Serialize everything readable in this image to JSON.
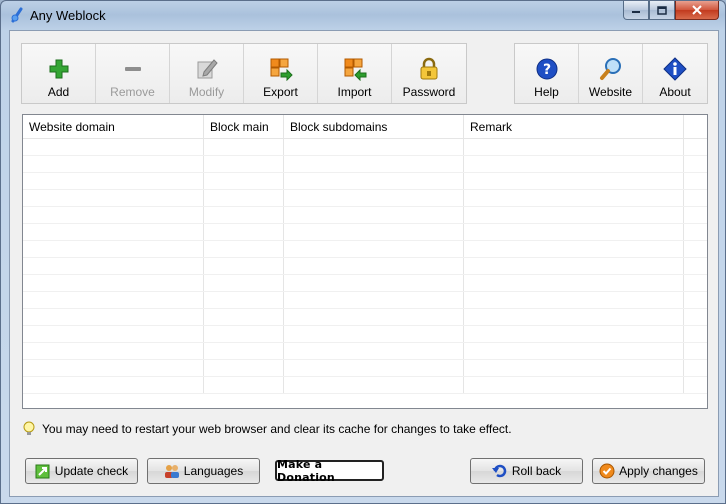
{
  "window": {
    "title": "Any Weblock"
  },
  "toolbar": {
    "left_buttons": [
      {
        "label": "Add",
        "icon": "plus-icon",
        "enabled": true
      },
      {
        "label": "Remove",
        "icon": "minus-icon",
        "enabled": false
      },
      {
        "label": "Modify",
        "icon": "pencil-icon",
        "enabled": false
      },
      {
        "label": "Export",
        "icon": "export-icon",
        "enabled": true
      },
      {
        "label": "Import",
        "icon": "import-icon",
        "enabled": true
      },
      {
        "label": "Password",
        "icon": "lock-icon",
        "enabled": true
      }
    ],
    "right_buttons": [
      {
        "label": "Help",
        "icon": "help-icon"
      },
      {
        "label": "Website",
        "icon": "magnifier-icon"
      },
      {
        "label": "About",
        "icon": "info-icon"
      }
    ]
  },
  "table": {
    "columns": [
      "Website domain",
      "Block main",
      "Block subdomains",
      "Remark"
    ],
    "rows": []
  },
  "notice": "You may need to restart your web browser and clear its cache for changes to take effect.",
  "buttons": {
    "update_check": "Update check",
    "languages": "Languages",
    "donation": "Make a Donation",
    "roll_back": "Roll back",
    "apply_changes": "Apply changes"
  },
  "colors": {
    "add_green": "#2e9e2e",
    "help_blue": "#1f4fc4",
    "accent_orange": "#f08a1c"
  }
}
